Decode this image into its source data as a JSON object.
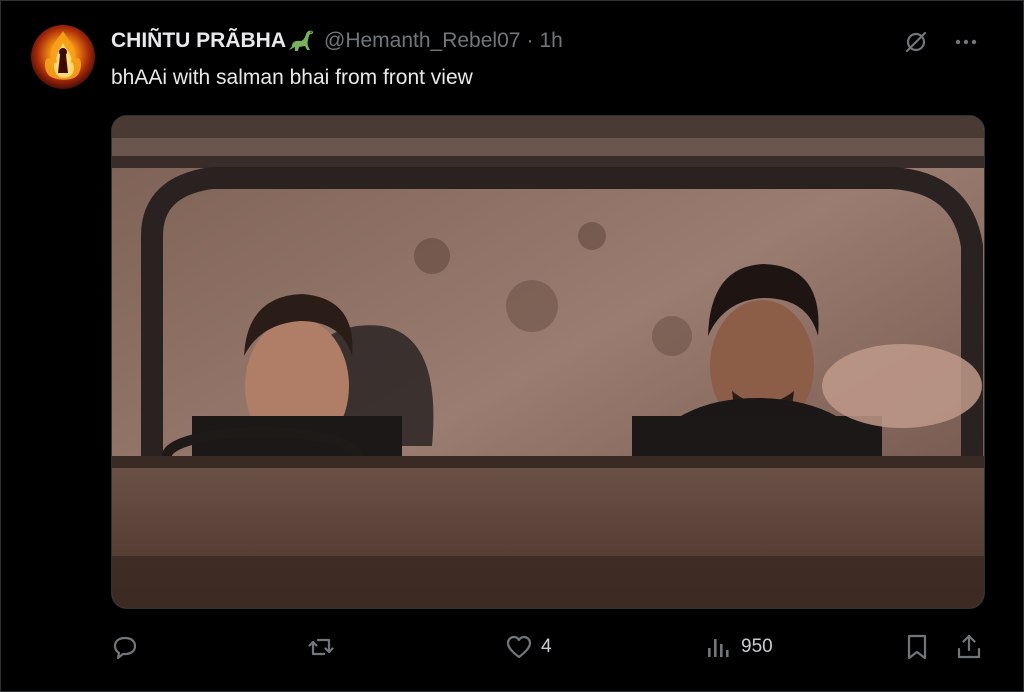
{
  "tweet": {
    "author": {
      "display_name": "CHIÑTU PRÃBHA",
      "badge_emoji": "sauropod-icon",
      "handle": "@Hemanth_Rebel07",
      "separator": "·",
      "time": "1h",
      "avatar_icon": "fire-avatar"
    },
    "text": "bhAAi with salman bhai from front view",
    "top_icons": [
      "grok-icon",
      "more-icon"
    ],
    "actions": {
      "reply": {
        "icon": "reply-icon",
        "count": ""
      },
      "retweet": {
        "icon": "retweet-icon",
        "count": ""
      },
      "like": {
        "icon": "heart-icon",
        "count": "4"
      },
      "views": {
        "icon": "views-icon",
        "count": "950"
      },
      "bookmark": {
        "icon": "bookmark-icon"
      },
      "share": {
        "icon": "share-icon"
      }
    }
  },
  "colors": {
    "background": "#000000",
    "primary_text": "#e7e9ea",
    "secondary_text": "#71767b",
    "border": "#2f3336"
  }
}
